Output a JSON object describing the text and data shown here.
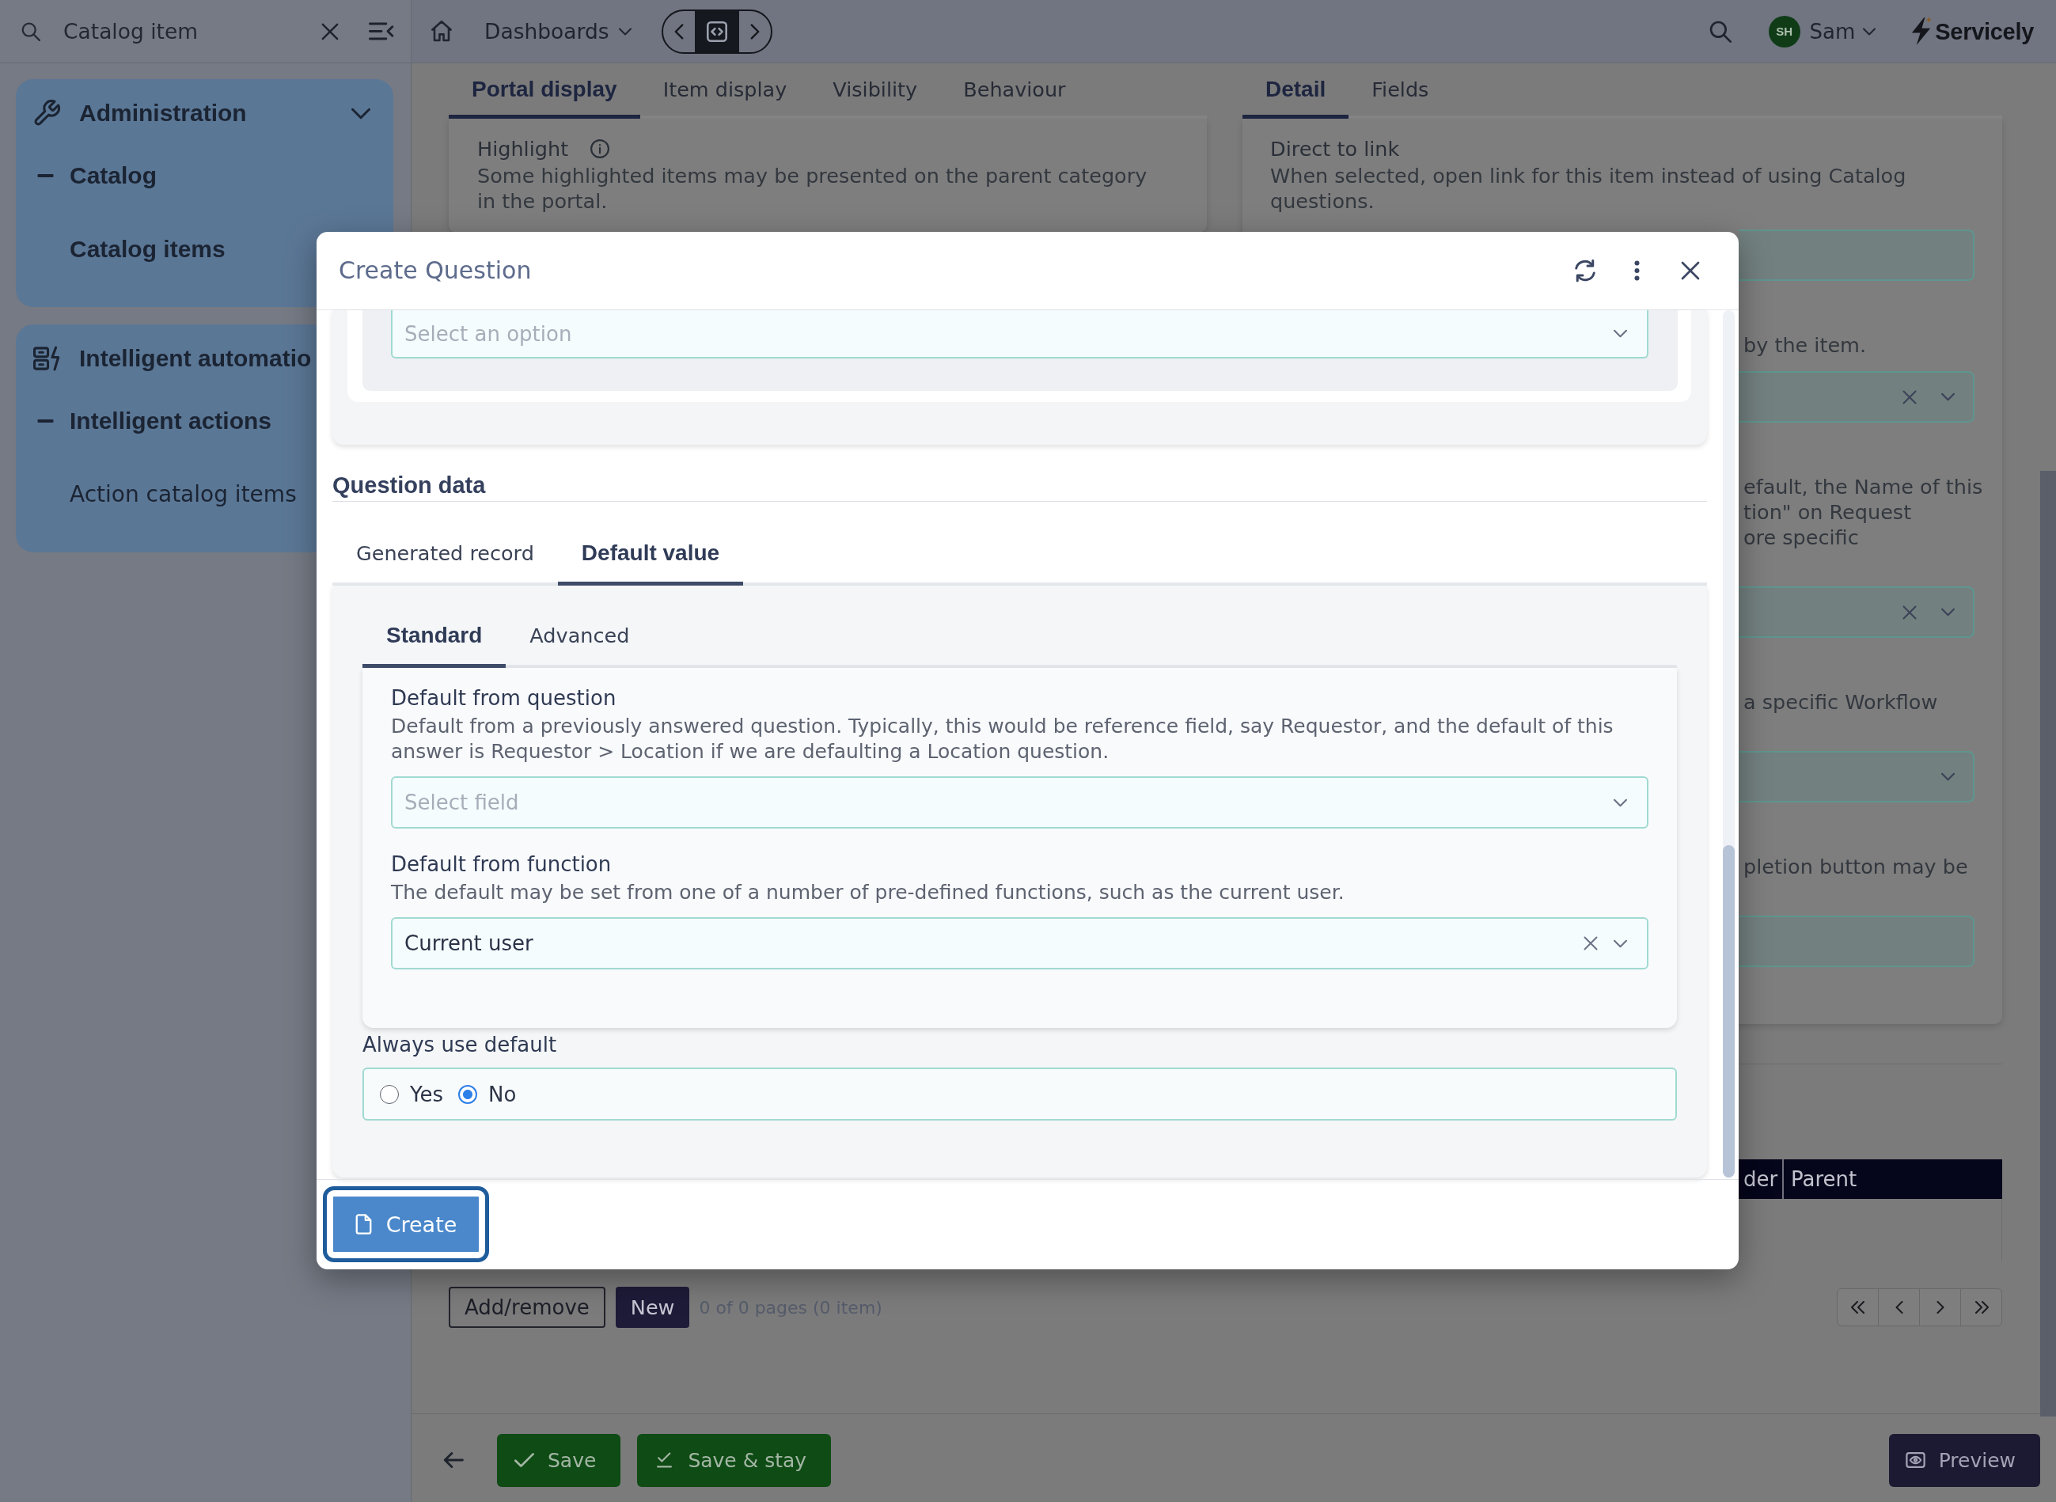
{
  "sidebar": {
    "search": {
      "value": "Catalog item"
    },
    "groups": [
      {
        "title": "Administration",
        "expanded": true,
        "items": [
          {
            "label": "Catalog",
            "expanded": true,
            "children": [
              {
                "label": "Catalog items",
                "selected": true
              }
            ]
          }
        ]
      },
      {
        "title": "Intelligent automatio",
        "items": [
          {
            "label": "Intelligent actions",
            "expanded": true,
            "children": [
              {
                "label": "Action catalog items",
                "selected": false
              }
            ]
          }
        ]
      }
    ]
  },
  "topbar": {
    "menu": "Dashboards",
    "user": {
      "initials": "SH",
      "name": "Sam"
    },
    "logo": "Servicely"
  },
  "left_panel": {
    "tabs": [
      {
        "label": "Portal display",
        "selected": true
      },
      {
        "label": "Item display",
        "selected": false
      },
      {
        "label": "Visibility",
        "selected": false
      },
      {
        "label": "Behaviour",
        "selected": false
      }
    ],
    "fields": [
      {
        "label": "Highlight",
        "info": true,
        "description": "Some highlighted items may be presented on the parent category in the portal."
      }
    ]
  },
  "right_panel": {
    "tabs": [
      {
        "label": "Detail",
        "selected": true
      },
      {
        "label": "Fields",
        "selected": false
      }
    ],
    "fields": [
      {
        "kind": "text",
        "label": "Direct to link",
        "description": "When selected, open link for this item instead of using Catalog questions."
      },
      {
        "kind": "select",
        "description_lines": [
          "by the item."
        ],
        "clearable": true
      },
      {
        "kind": "select",
        "description_lines": [
          "efault, the Name of this",
          "tion\" on Request",
          "ore specific"
        ],
        "clearable": true
      },
      {
        "kind": "select",
        "description_lines": [
          "a specific Workflow"
        ],
        "clearable": false
      },
      {
        "kind": "text",
        "description_lines": [
          "pletion button may be"
        ]
      }
    ]
  },
  "table": {
    "columns": [
      "der",
      "Parent"
    ]
  },
  "list_actions": {
    "buttons": [
      {
        "label": "Add/remove",
        "kind": "outline"
      },
      {
        "label": "New",
        "kind": "primary"
      }
    ],
    "page_info": "0 of 0 pages (0 item)"
  },
  "footer": {
    "buttons": [
      {
        "label": "Save",
        "kind": "save"
      },
      {
        "label": "Save & stay",
        "kind": "save_stay"
      },
      {
        "label": "Preview",
        "kind": "preview"
      }
    ]
  },
  "modal": {
    "title": "Create Question",
    "top_field": {
      "placeholder": "Select an option"
    },
    "section_title": "Question data",
    "tabs": [
      {
        "label": "Generated record",
        "selected": false
      },
      {
        "label": "Default value",
        "selected": true
      }
    ],
    "subtabs": [
      {
        "label": "Standard",
        "selected": true
      },
      {
        "label": "Advanced",
        "selected": false
      }
    ],
    "fields": [
      {
        "label": "Default from question",
        "description": "Default from a previously answered question. Typically, this would be reference field, say Requestor, and the default of this answer is Requestor > Location if we are defaulting a Location question.",
        "placeholder": "Select field",
        "clearable": false
      },
      {
        "label": "Default from function",
        "description": "The default may be set from one of a number of pre-defined functions, such as the current user.",
        "value": "Current user",
        "clearable": true
      }
    ],
    "always_use_default": {
      "label": "Always use default",
      "options": [
        {
          "label": "Yes",
          "selected": false
        },
        {
          "label": "No",
          "selected": true
        }
      ]
    },
    "primary_button": "Create"
  }
}
